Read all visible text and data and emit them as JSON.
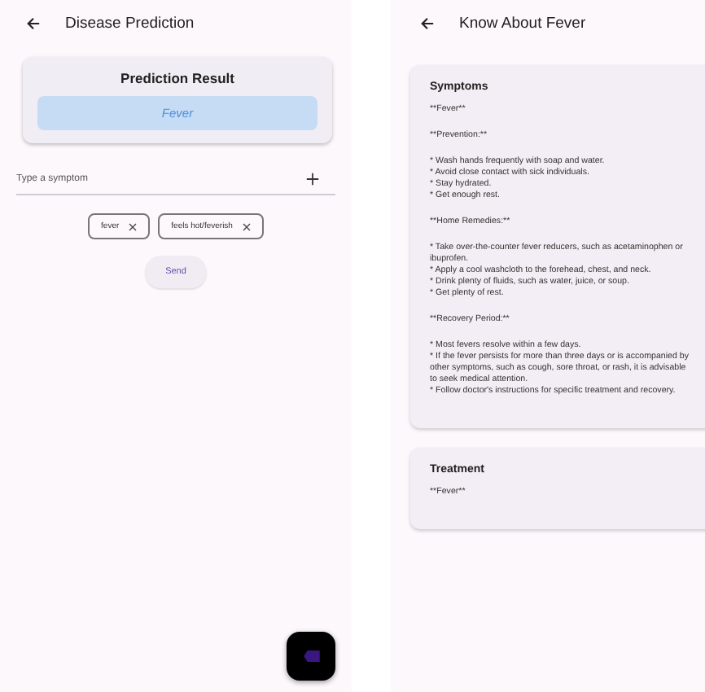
{
  "prediction_screen": {
    "title": "Disease Prediction",
    "result_card": {
      "title": "Prediction Result",
      "result": "Fever"
    },
    "symptom_field": {
      "placeholder": "Type a symptom"
    },
    "chips": [
      {
        "label": "fever"
      },
      {
        "label": "feels hot/feverish"
      }
    ],
    "send_button": "Send"
  },
  "info_screen": {
    "title": "Know About Fever",
    "cards": [
      {
        "title": "Symptoms",
        "blocks": [
          [
            "**Fever**"
          ],
          [
            "**Prevention:**"
          ],
          [
            "* Wash hands frequently with soap and water.",
            "* Avoid close contact with sick individuals.",
            "* Stay hydrated.",
            "* Get enough rest."
          ],
          [
            "**Home Remedies:**"
          ],
          [
            "* Take over-the-counter fever reducers, such as acetaminophen or ibuprofen.",
            "* Apply a cool washcloth to the forehead, chest, and neck.",
            "* Drink plenty of fluids, such as water, juice, or soup.",
            "* Get plenty of rest."
          ],
          [
            "**Recovery Period:**"
          ],
          [
            "* Most fevers resolve within a few days.",
            "* If the fever persists for more than three days or is accompanied by other symptoms, such as cough, sore throat, or rash, it is advisable to seek medical attention.",
            "* Follow doctor's instructions for specific treatment and recovery."
          ]
        ]
      },
      {
        "title": "Treatment",
        "blocks": [
          [
            "**Fever**"
          ]
        ]
      }
    ]
  }
}
